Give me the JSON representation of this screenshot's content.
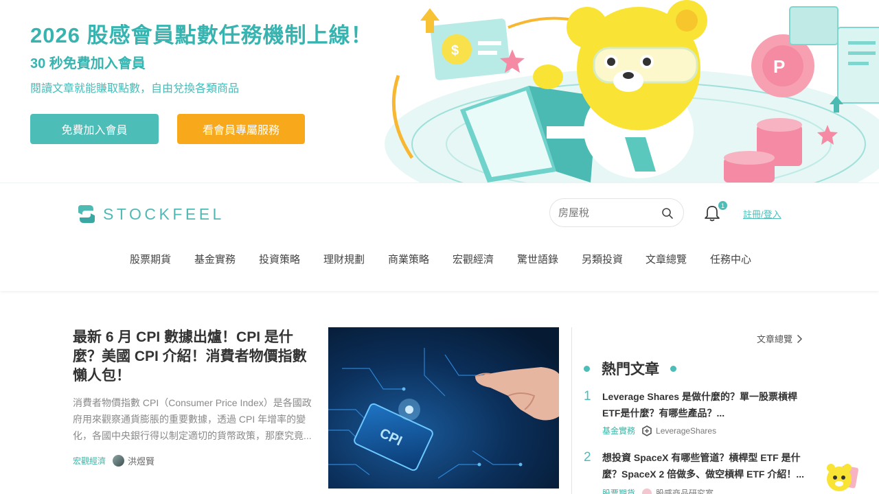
{
  "banner": {
    "title": "2026 股感會員點數任務機制上線！",
    "subtitle": "30 秒免費加入會員",
    "description": "閱讀文章就能賺取點數，自由兌換各類商品",
    "join_button": "免費加入會員",
    "vip_button": "看會員專屬服務",
    "colors": {
      "accent": "#37b3b0",
      "button_teal": "#4dbdb8",
      "button_orange": "#f8a91b"
    }
  },
  "header": {
    "logo_text": "STOCKFEEL",
    "search_placeholder": "房屋稅",
    "notification_count": "1",
    "login_label": "註冊/登入"
  },
  "nav": {
    "items": [
      "股票期貨",
      "基金實務",
      "投資策略",
      "理財規劃",
      "商業策略",
      "宏觀經濟",
      "驚世語錄",
      "另類投資",
      "文章總覽",
      "任務中心"
    ]
  },
  "feature": {
    "title": "最新 6 月 CPI 數據出爐！CPI 是什麼？美國 CPI 介紹！消費者物價指數懶人包！",
    "excerpt": "消費者物價指數 CPI（Consumer Price Index）是各國政府用來觀察通貨膨脹的重要數據，透過 CPI 年增率的變化，各國中央銀行得以制定適切的貨幣政策，那麼究竟...",
    "category": "宏觀經濟",
    "author": "洪煜賢",
    "image_label": "CPI"
  },
  "sidebar": {
    "overview_link": "文章總覽",
    "hot_title": "熱門文章",
    "articles": [
      {
        "rank": "1",
        "title": "Leverage Shares 是做什麼的？單一股票槓桿ETF是什麼？有哪些產品？...",
        "category": "基金實務",
        "source": "LeverageShares"
      },
      {
        "rank": "2",
        "title": "想投資 SpaceX 有哪些管道？槓桿型 ETF 是什麼？SpaceX 2 倍做多、做空槓桿 ETF 介紹！...",
        "category": "股票期貨",
        "source": "股感商品研究室"
      }
    ]
  }
}
